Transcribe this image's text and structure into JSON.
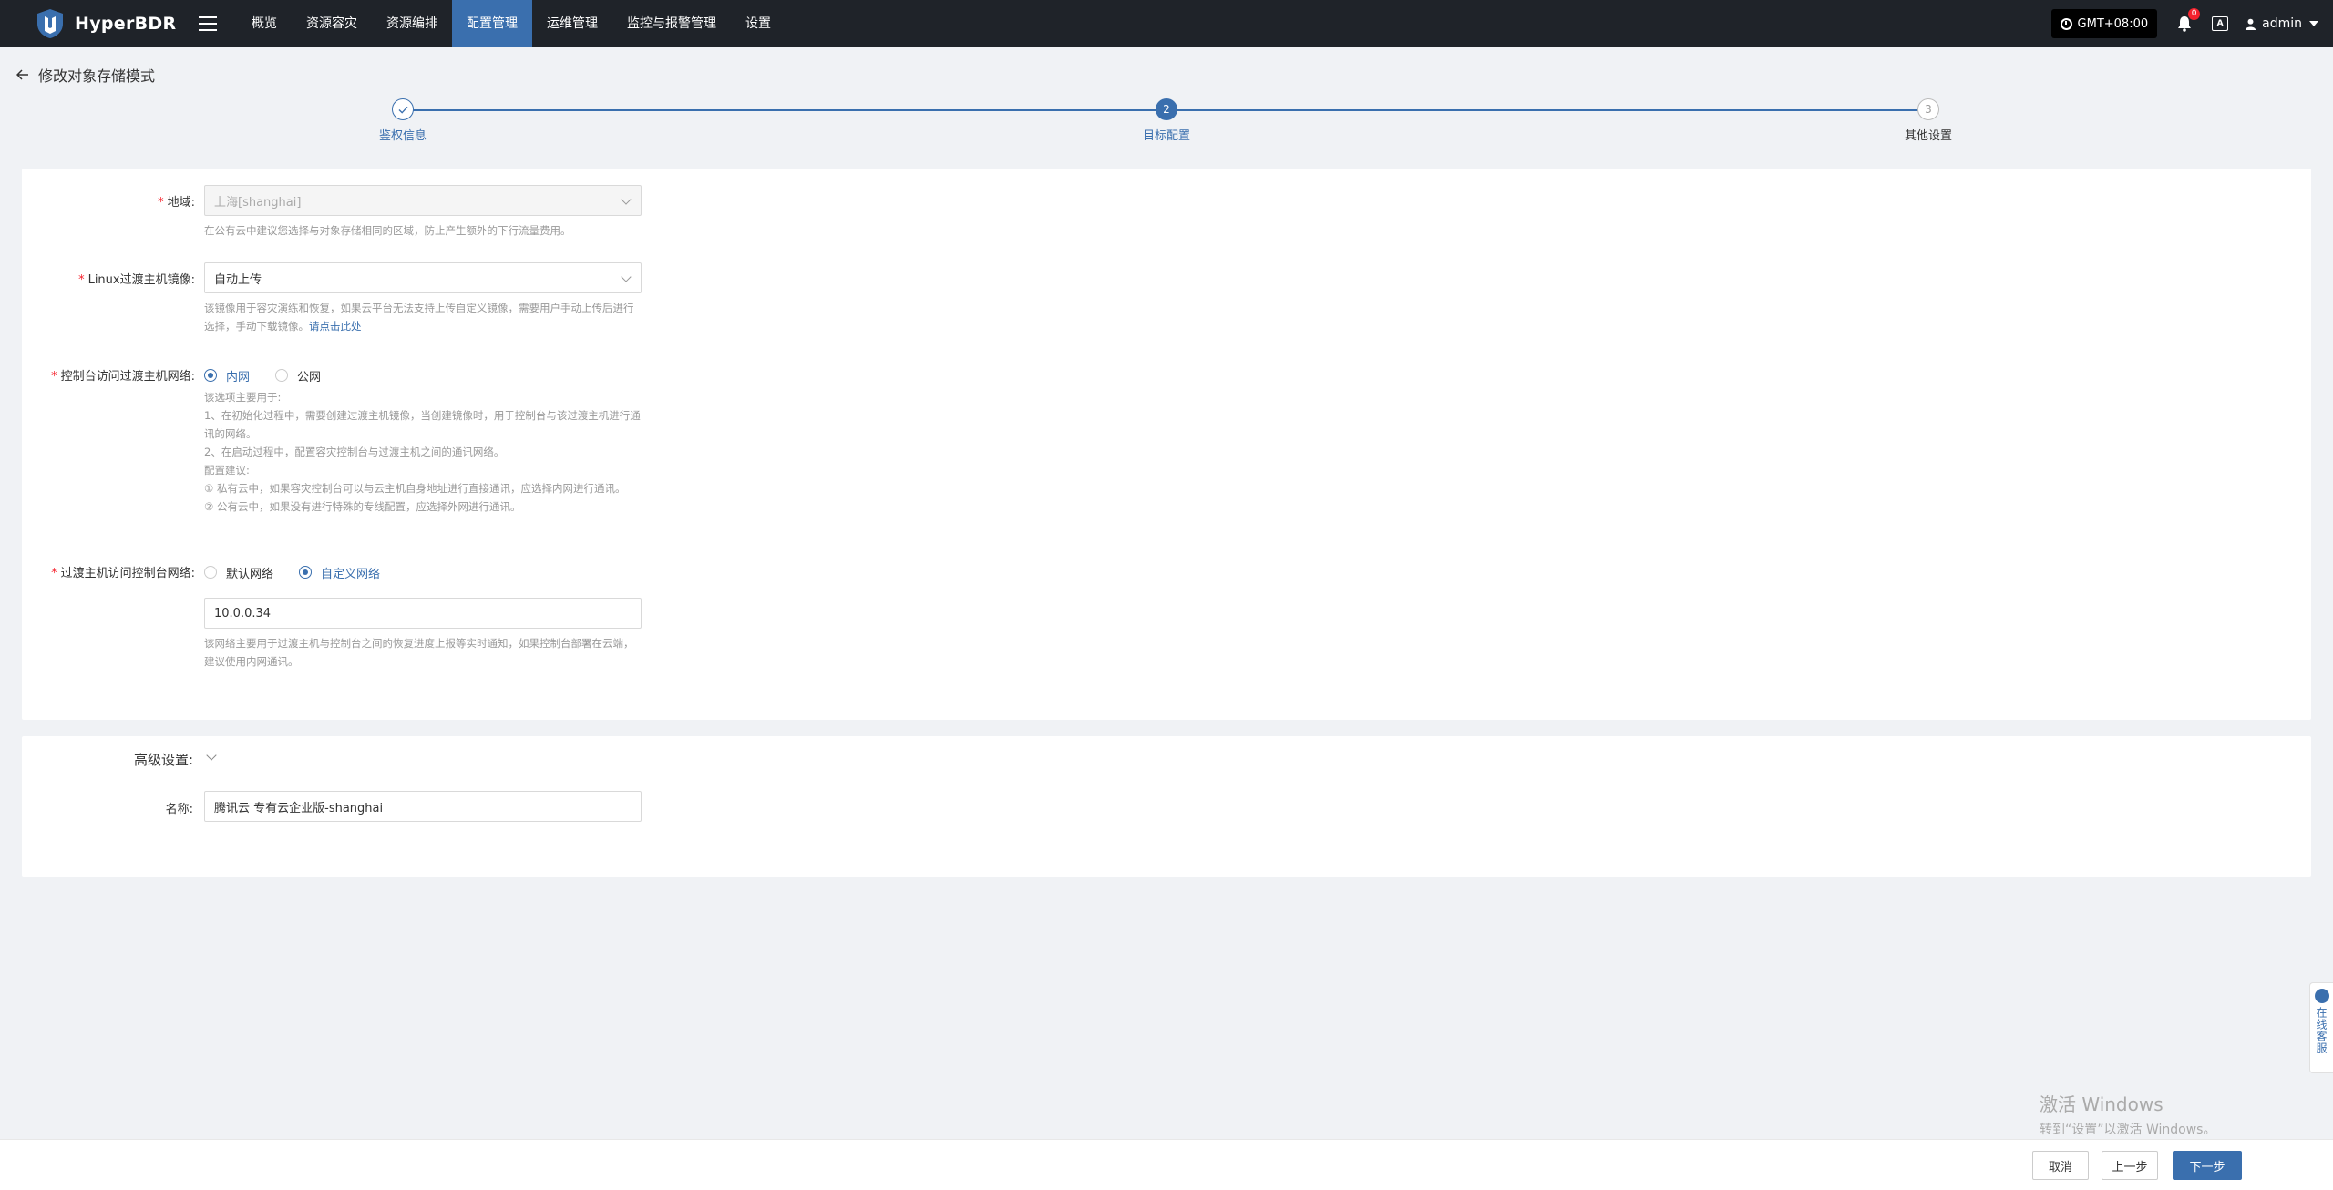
{
  "app": {
    "name": "HyperBDR"
  },
  "nav": {
    "items": [
      "概览",
      "资源容灾",
      "资源编排",
      "配置管理",
      "运维管理",
      "监控与报警管理",
      "设置"
    ],
    "active_index": 3
  },
  "topbar": {
    "timezone": "GMT+08:00",
    "alert_count": "0",
    "lang_icon_text": "A",
    "user": "admin"
  },
  "page": {
    "title": "修改对象存储模式"
  },
  "steps": [
    {
      "index": "1",
      "label": "鉴权信息",
      "status": "done"
    },
    {
      "index": "2",
      "label": "目标配置",
      "status": "active"
    },
    {
      "index": "3",
      "label": "其他设置",
      "status": "todo"
    }
  ],
  "form": {
    "region": {
      "label": "地域:",
      "value": "上海[shanghai]",
      "help": "在公有云中建议您选择与对象存储相同的区域，防止产生额外的下行流量费用。"
    },
    "linux_image": {
      "label": "Linux过渡主机镜像:",
      "value": "自动上传",
      "help": "该镜像用于容灾演练和恢复，如果云平台无法支持上传自定义镜像，需要用户手动上传后进行选择，手动下载镜像。",
      "help_link": "请点击此处"
    },
    "console_network": {
      "label": "控制台访问过渡主机网络:",
      "options": [
        "内网",
        "公网"
      ],
      "selected_index": 0,
      "help_lines": [
        "该选项主要用于:",
        "1、在初始化过程中，需要创建过渡主机镜像，当创建镜像时，用于控制台与该过渡主机进行通讯的网络。",
        "2、在启动过程中，配置容灾控制台与过渡主机之间的通讯网络。",
        "配置建议:",
        "① 私有云中，如果容灾控制台可以与云主机自身地址进行直接通讯，应选择内网进行通讯。",
        "② 公有云中，如果没有进行特殊的专线配置，应选择外网进行通讯。"
      ]
    },
    "host_network": {
      "label": "过渡主机访问控制台网络:",
      "options": [
        "默认网络",
        "自定义网络"
      ],
      "selected_index": 1,
      "value": "10.0.0.34",
      "help": "该网络主要用于过渡主机与控制台之间的恢复进度上报等实时通知，如果控制台部署在云端，建议使用内网通讯。"
    }
  },
  "advanced": {
    "label": "高级设置:",
    "name_label": "名称:",
    "name_value": "腾讯云 专有云企业版-shanghai"
  },
  "footer": {
    "cancel": "取消",
    "prev": "上一步",
    "next": "下一步"
  },
  "service": {
    "label": "在线客服"
  },
  "watermark": {
    "line1": "激活 Windows",
    "line2": "转到“设置”以激活 Windows。"
  },
  "colors": {
    "brand": "#3a6fae",
    "topbar": "#1f2329",
    "required": "#f5222d"
  }
}
